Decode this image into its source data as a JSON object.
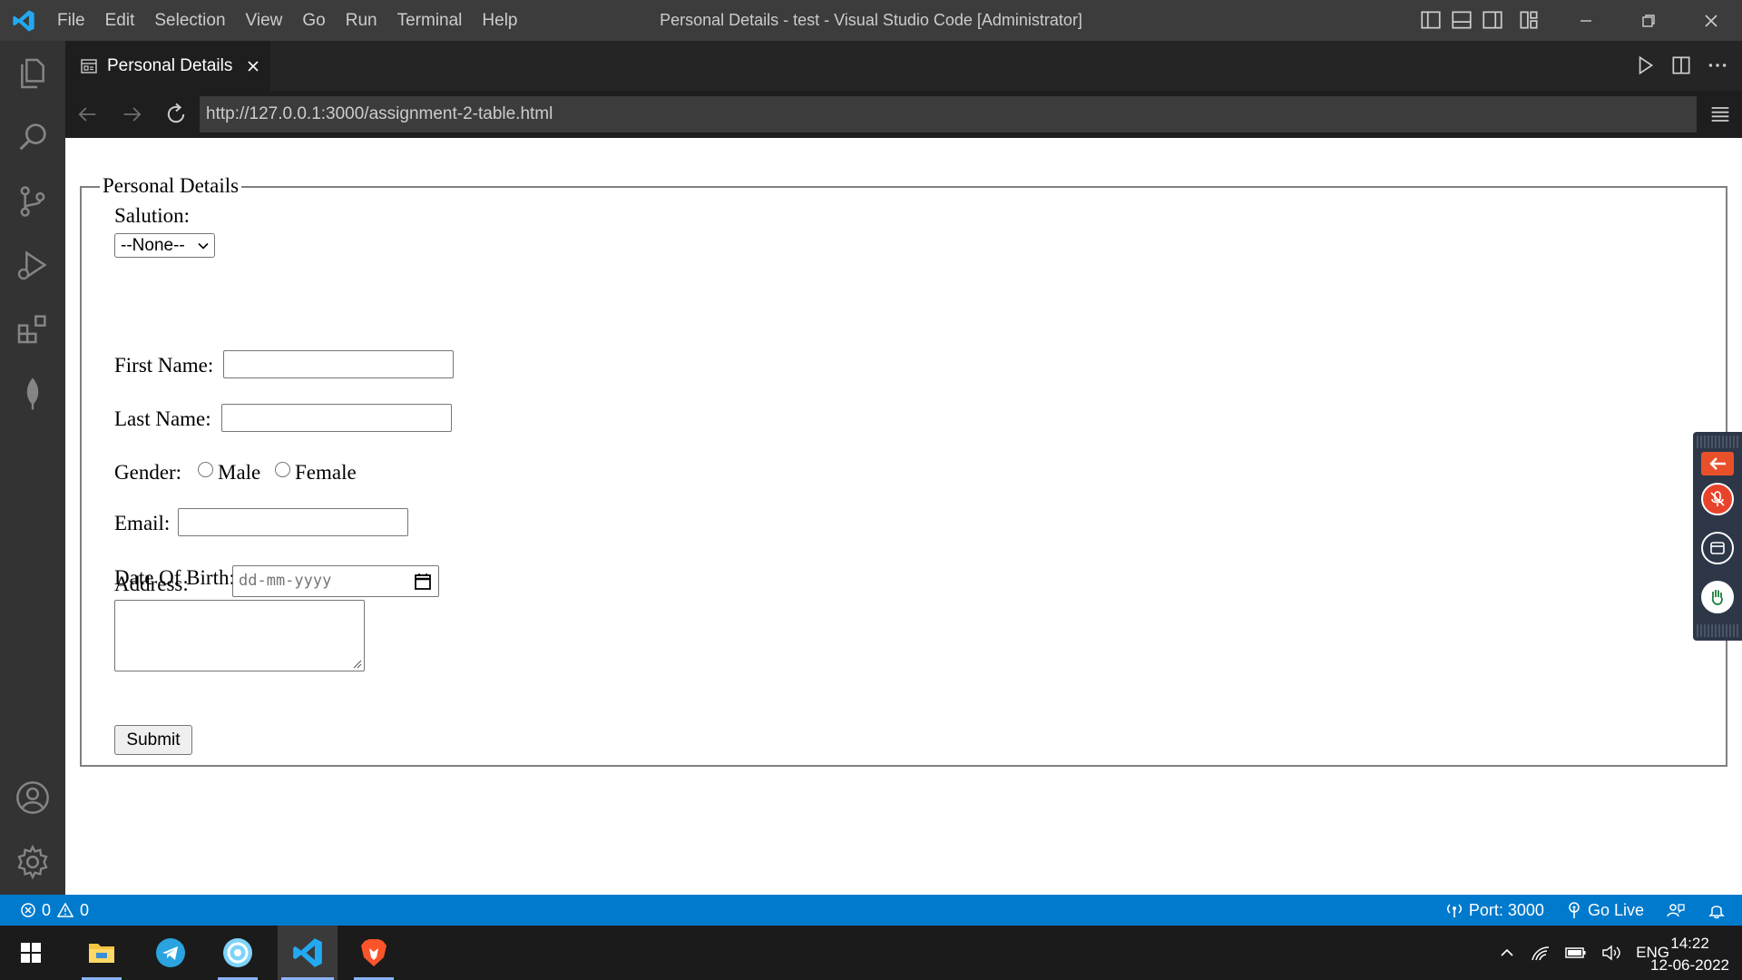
{
  "titlebar": {
    "menu": [
      "File",
      "Edit",
      "Selection",
      "View",
      "Go",
      "Run",
      "Terminal",
      "Help"
    ],
    "title": "Personal Details - test - Visual Studio Code [Administrator]"
  },
  "tab": {
    "label": "Personal Details"
  },
  "browser": {
    "url": "http://127.0.0.1:3000/assignment-2-table.html"
  },
  "form": {
    "legend": "Personal Details",
    "salution_label": "Salution:",
    "salution_value": "--None--",
    "first_name_label": "First Name:",
    "last_name_label": "Last Name:",
    "gender_label": "Gender:",
    "gender_options": [
      "Male",
      "Female"
    ],
    "email_label": "Email:",
    "dob_label": "Date Of Birth:",
    "dob_placeholder": "dd-mm-yyyy",
    "address_label": "Address:",
    "submit_label": "Submit"
  },
  "statusbar": {
    "errors": "0",
    "warnings": "0",
    "port": "Port: 3000",
    "go_live": "Go Live"
  },
  "taskbar": {
    "language": "ENG",
    "time": "14:22",
    "date": "12-06-2022"
  },
  "colors": {
    "accent": "#007acc",
    "titlebar": "#3c3c3c",
    "activitybar": "#333333"
  }
}
